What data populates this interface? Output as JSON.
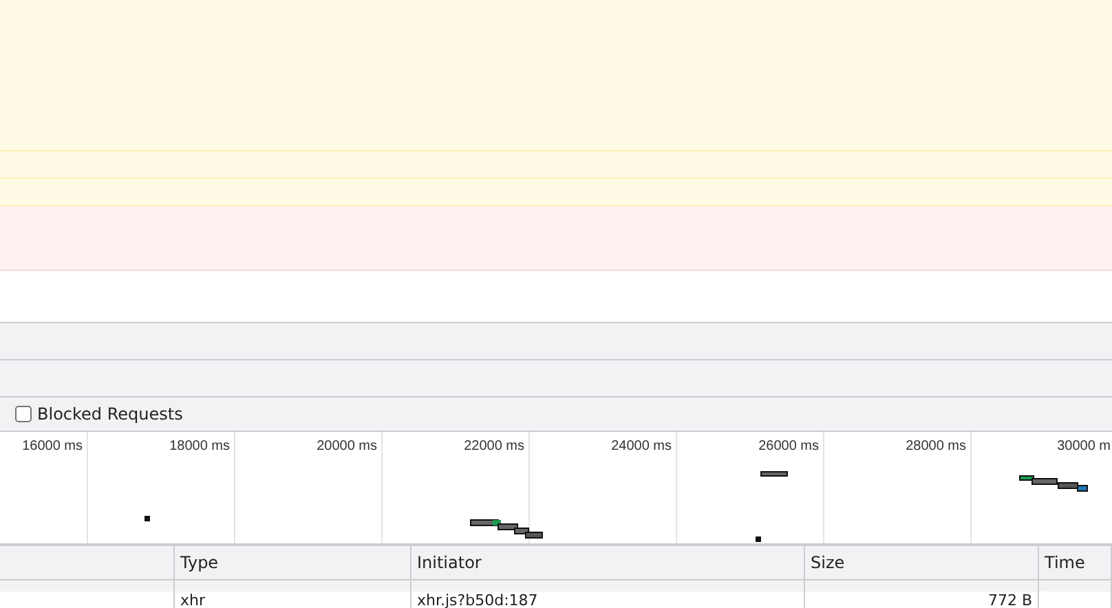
{
  "message_rows": [
    {
      "kind": "warning"
    },
    {
      "kind": "warning"
    },
    {
      "kind": "warning"
    },
    {
      "kind": "error"
    },
    {
      "kind": "plain"
    }
  ],
  "filter_bar": {
    "blocked_requests": {
      "label": "Blocked Requests",
      "checked": false
    }
  },
  "timeline": {
    "ticks": [
      "16000 ms",
      "18000 ms",
      "20000 ms",
      "22000 ms",
      "24000 ms",
      "26000 ms",
      "28000 ms",
      "30000 m"
    ]
  },
  "table": {
    "columns": [
      "",
      "Type",
      "Initiator",
      "Size",
      "Time"
    ],
    "rows": [
      {
        "cells": [
          "",
          "xhr",
          "xhr.js?b50d:187",
          "772 B",
          ""
        ]
      }
    ]
  }
}
